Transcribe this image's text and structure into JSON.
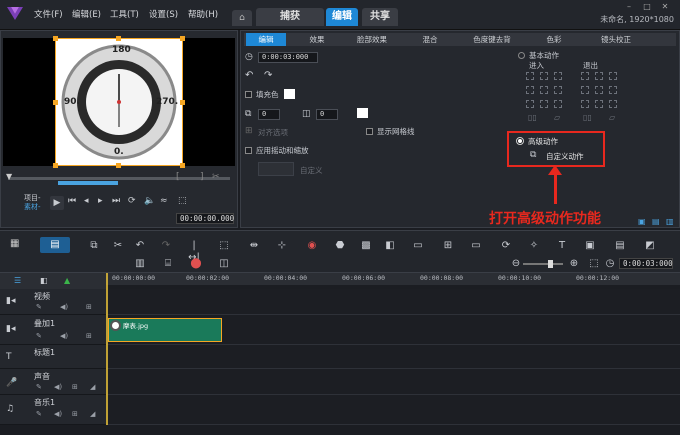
{
  "menu": [
    "文件(F)",
    "编辑(E)",
    "工具(T)",
    "设置(S)",
    "帮助(H)"
  ],
  "tabs": {
    "home_icon": "home-icon",
    "items": [
      "捕获",
      "编辑",
      "共享"
    ],
    "active": "编辑"
  },
  "doc_title": "未命名, 1920*1080",
  "preview": {
    "clock_marks": {
      "top": "180",
      "left": "90.",
      "right": "270.",
      "bottom": "0."
    },
    "labels": {
      "project": "项目-",
      "clip": "素材-"
    },
    "timecode": "00:00:00.000"
  },
  "options": {
    "subtabs": [
      "编辑",
      "效果",
      "脸部效果",
      "混合",
      "色度键去背",
      "色彩",
      "镜头校正"
    ],
    "active_subtab": "编辑",
    "duration": "0:00:03:000",
    "fill_color_label": "填充色",
    "spinner1": "0",
    "spinner2": "0",
    "align_label": "对齐选项",
    "show_grid_label": "显示网格线",
    "pan_zoom_label": "应用摇动和缩放",
    "custom_label": "自定义",
    "basic_motion_label": "基本动作",
    "enter_label": "进入",
    "exit_label": "退出",
    "advanced_motion_label": "高级动作",
    "custom_motion_label": "自定义动作"
  },
  "annotation": {
    "caption": "打开高级动作功能",
    "color": "#e8281e"
  },
  "timeline": {
    "timecode": "0:00:03:000",
    "ruler": [
      "00:00:00:00",
      "00:00:02:00",
      "00:00:04:00",
      "00:00:06:00",
      "00:00:08:00",
      "00:00:10:00",
      "00:00:12:00"
    ],
    "tracks": [
      "视频",
      "叠加1",
      "标题1",
      "声音",
      "音乐1"
    ],
    "clip_name": "摩表.jpg"
  },
  "colors": {
    "accent": "#1e88d6",
    "selection": "#f5a623",
    "clip": "#1a7a5a"
  }
}
